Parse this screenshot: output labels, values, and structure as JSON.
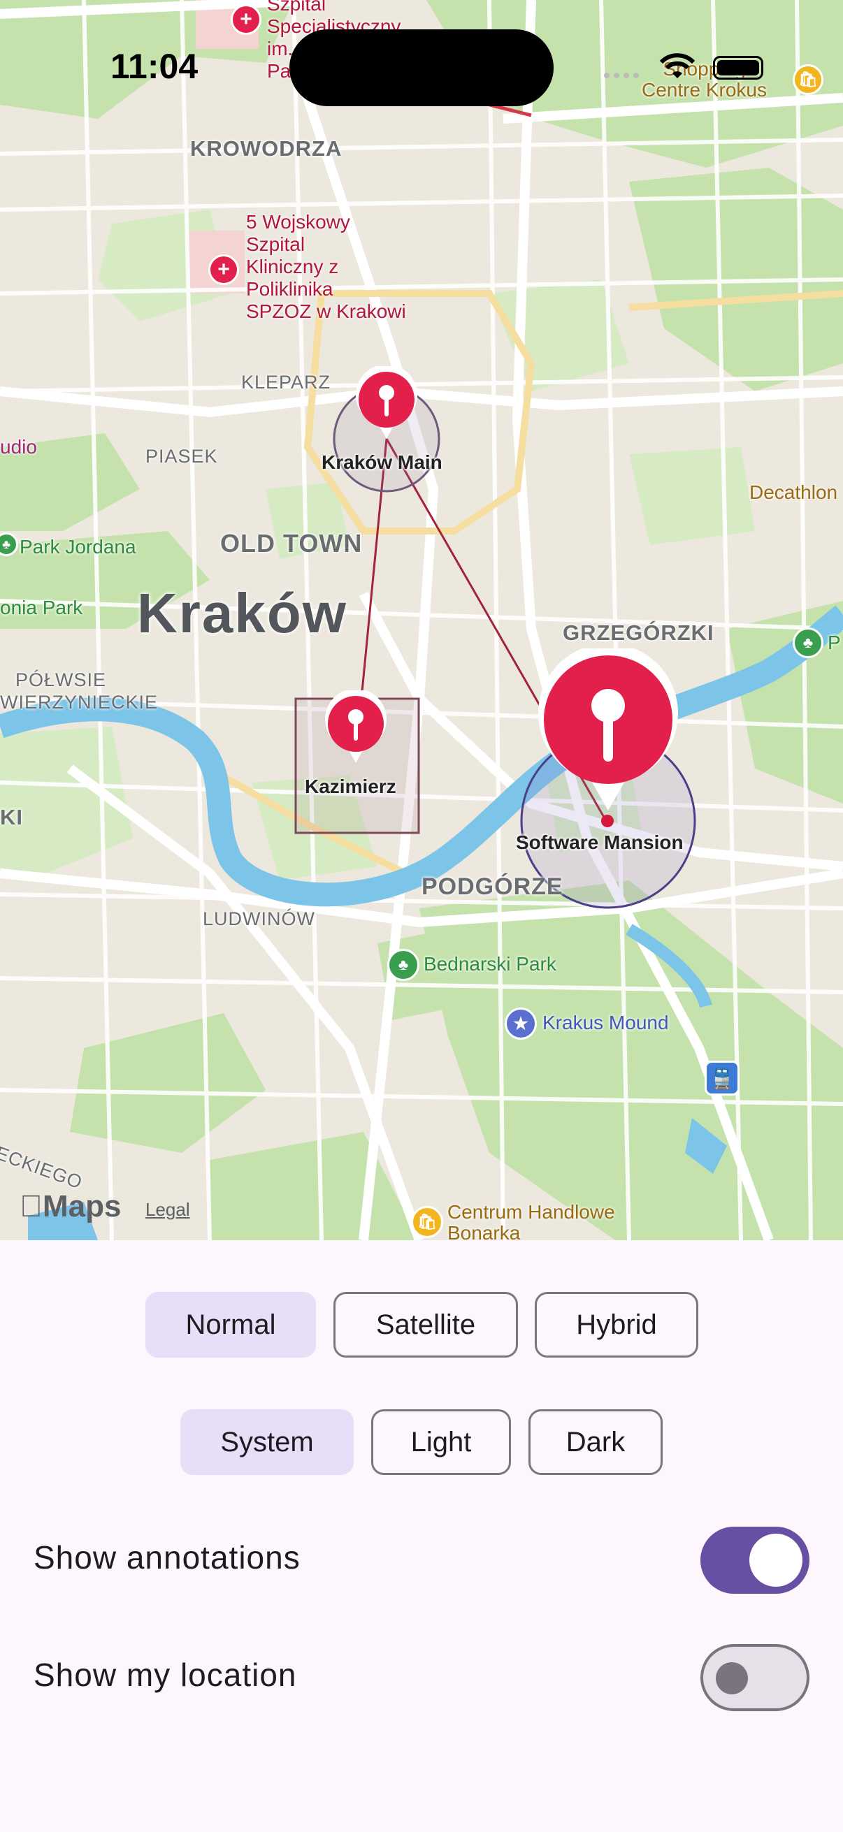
{
  "status_bar": {
    "time": "11:04"
  },
  "map": {
    "attribution": {
      "logo_text": "Maps",
      "legal_label": "Legal"
    },
    "city_label": "Kraków",
    "districts": [
      "KROWODRZA",
      "KLEPARZ",
      "PIASEK",
      "OLD TOWN",
      "GRZEGÓRZKI",
      "PÓŁWSIE",
      "WIERZYNIECKIE",
      "PODGÓRZE",
      "LUDWINÓW",
      "ECKIEGO",
      "KI"
    ],
    "pois": {
      "hospital_top": "Szpital Specjalistyczny im. Pa",
      "hospital_top_lines": [
        "Szpital",
        "Specjalistyczny",
        "im.",
        "Pa"
      ],
      "hospital_mid_lines": [
        "5 Wojskowy",
        "Szpital",
        "Kliniczny z",
        "Poliklinika",
        "SPZOZ w Krakowi"
      ],
      "shopping_lines": [
        "Shopping",
        "Centre Krokus"
      ],
      "studio": "udio",
      "decathlon": "Decathlon",
      "park_jordana": "Park Jordana",
      "blonia_park": "onia Park",
      "bednarski_park": "Bednarski Park",
      "krakus_mound": "Krakus Mound",
      "centrum_lines": [
        "Centrum Handlowe",
        "Bonarka"
      ],
      "park_right": "P"
    },
    "annotations": [
      {
        "name": "Kraków Main"
      },
      {
        "name": "Kazimierz"
      },
      {
        "name": "Software Mansion"
      }
    ]
  },
  "controls": {
    "map_type": {
      "options": [
        "Normal",
        "Satellite",
        "Hybrid"
      ],
      "selected": "Normal"
    },
    "color_scheme": {
      "options": [
        "System",
        "Light",
        "Dark"
      ],
      "selected": "System"
    },
    "toggles": [
      {
        "label": "Show annotations",
        "on": true
      },
      {
        "label": "Show my location",
        "on": false
      }
    ]
  },
  "colors": {
    "accent": "#6750a4",
    "selected_segment": "#e8def8",
    "pin": "#e3204b",
    "water": "#7cc4e8",
    "park": "#bfe0a6"
  }
}
